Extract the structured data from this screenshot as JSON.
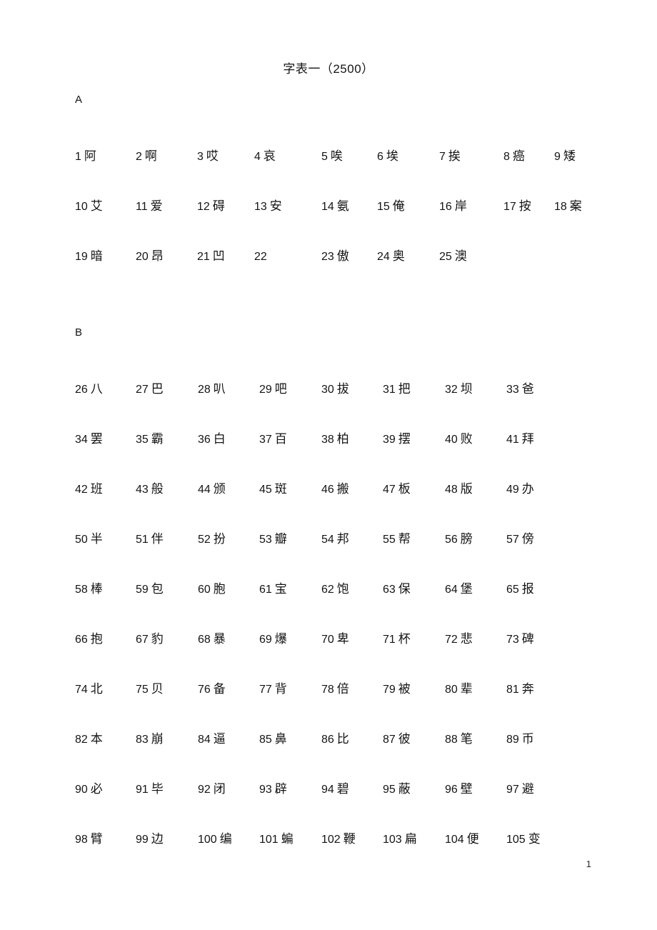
{
  "document": {
    "title": "字表一（2500）",
    "page_number": "1"
  },
  "sections": [
    {
      "letter": "A",
      "columns": 9,
      "column_x": [
        7,
        92,
        178,
        258,
        352,
        430,
        517,
        607,
        678
      ],
      "rows": [
        [
          {
            "num": "1",
            "char": "阿"
          },
          {
            "num": "2",
            "char": "啊"
          },
          {
            "num": "3",
            "char": "哎"
          },
          {
            "num": "4",
            "char": "哀"
          },
          {
            "num": "5",
            "char": "唉"
          },
          {
            "num": "6",
            "char": "埃"
          },
          {
            "num": "7",
            "char": "挨"
          },
          {
            "num": "8",
            "char": "癌"
          },
          {
            "num": "9",
            "char": "矮"
          }
        ],
        [
          {
            "num": "10",
            "char": "艾"
          },
          {
            "num": "11",
            "char": "爱"
          },
          {
            "num": "12",
            "char": "碍"
          },
          {
            "num": "13",
            "char": "安"
          },
          {
            "num": "14",
            "char": "氨"
          },
          {
            "num": "15",
            "char": "俺"
          },
          {
            "num": "16",
            "char": "岸"
          },
          {
            "num": "17",
            "char": "按"
          },
          {
            "num": "18",
            "char": "案"
          }
        ],
        [
          {
            "num": "19",
            "char": "暗"
          },
          {
            "num": "20",
            "char": "昂"
          },
          {
            "num": "21",
            "char": "凹"
          },
          {
            "num": "22",
            "char": ""
          },
          {
            "num": "23",
            "char": "傲"
          },
          {
            "num": "24",
            "char": "奥"
          },
          {
            "num": "25",
            "char": "澳"
          }
        ]
      ]
    },
    {
      "letter": "B",
      "columns": 8,
      "column_x": [
        7,
        92,
        179,
        265,
        352,
        438,
        525,
        611
      ],
      "rows": [
        [
          {
            "num": "26",
            "char": "八"
          },
          {
            "num": "27",
            "char": "巴"
          },
          {
            "num": "28",
            "char": "叭"
          },
          {
            "num": "29",
            "char": "吧"
          },
          {
            "num": "30",
            "char": "拔"
          },
          {
            "num": "31",
            "char": "把"
          },
          {
            "num": "32",
            "char": "坝"
          },
          {
            "num": "33",
            "char": "爸"
          }
        ],
        [
          {
            "num": "34",
            "char": "罢"
          },
          {
            "num": "35",
            "char": "霸"
          },
          {
            "num": "36",
            "char": "白"
          },
          {
            "num": "37",
            "char": "百"
          },
          {
            "num": "38",
            "char": "柏"
          },
          {
            "num": "39",
            "char": "摆"
          },
          {
            "num": "40",
            "char": "败"
          },
          {
            "num": "41",
            "char": "拜"
          }
        ],
        [
          {
            "num": "42",
            "char": "班"
          },
          {
            "num": "43",
            "char": "般"
          },
          {
            "num": "44",
            "char": "颁"
          },
          {
            "num": "45",
            "char": "斑"
          },
          {
            "num": "46",
            "char": "搬"
          },
          {
            "num": "47",
            "char": "板"
          },
          {
            "num": "48",
            "char": "版"
          },
          {
            "num": "49",
            "char": "办"
          }
        ],
        [
          {
            "num": "50",
            "char": "半"
          },
          {
            "num": "51",
            "char": "伴"
          },
          {
            "num": "52",
            "char": "扮"
          },
          {
            "num": "53",
            "char": "瓣"
          },
          {
            "num": "54",
            "char": "邦"
          },
          {
            "num": "55",
            "char": "帮"
          },
          {
            "num": "56",
            "char": "膀"
          },
          {
            "num": "57",
            "char": "傍"
          }
        ],
        [
          {
            "num": "58",
            "char": "棒"
          },
          {
            "num": "59",
            "char": "包"
          },
          {
            "num": "60",
            "char": "胞"
          },
          {
            "num": "61",
            "char": "宝"
          },
          {
            "num": "62",
            "char": "饱"
          },
          {
            "num": "63",
            "char": "保"
          },
          {
            "num": "64",
            "char": "堡"
          },
          {
            "num": "65",
            "char": "报"
          }
        ],
        [
          {
            "num": "66",
            "char": "抱"
          },
          {
            "num": "67",
            "char": "豹"
          },
          {
            "num": "68",
            "char": "暴"
          },
          {
            "num": "69",
            "char": "爆"
          },
          {
            "num": "70",
            "char": "卑"
          },
          {
            "num": "71",
            "char": "杯"
          },
          {
            "num": "72",
            "char": "悲"
          },
          {
            "num": "73",
            "char": "碑"
          }
        ],
        [
          {
            "num": "74",
            "char": "北"
          },
          {
            "num": "75",
            "char": "贝"
          },
          {
            "num": "76",
            "char": "备"
          },
          {
            "num": "77",
            "char": "背"
          },
          {
            "num": "78",
            "char": "倍"
          },
          {
            "num": "79",
            "char": "被"
          },
          {
            "num": "80",
            "char": "辈"
          },
          {
            "num": "81",
            "char": "奔"
          }
        ],
        [
          {
            "num": "82",
            "char": "本"
          },
          {
            "num": "83",
            "char": "崩"
          },
          {
            "num": "84",
            "char": "逼"
          },
          {
            "num": "85",
            "char": "鼻"
          },
          {
            "num": "86",
            "char": "比"
          },
          {
            "num": "87",
            "char": "彼"
          },
          {
            "num": "88",
            "char": "笔"
          },
          {
            "num": "89",
            "char": "币"
          }
        ],
        [
          {
            "num": "90",
            "char": "必"
          },
          {
            "num": "91",
            "char": "毕"
          },
          {
            "num": "92",
            "char": "闭"
          },
          {
            "num": "93",
            "char": "辟"
          },
          {
            "num": "94",
            "char": "碧"
          },
          {
            "num": "95",
            "char": "蔽"
          },
          {
            "num": "96",
            "char": "壁"
          },
          {
            "num": "97",
            "char": "避"
          }
        ],
        [
          {
            "num": "98",
            "char": "臂"
          },
          {
            "num": "99",
            "char": "边"
          },
          {
            "num": "100",
            "char": "编"
          },
          {
            "num": "101",
            "char": "蝙"
          },
          {
            "num": "102",
            "char": "鞭"
          },
          {
            "num": "103",
            "char": "扁"
          },
          {
            "num": "104",
            "char": "便"
          },
          {
            "num": "105",
            "char": "变"
          }
        ]
      ]
    }
  ]
}
